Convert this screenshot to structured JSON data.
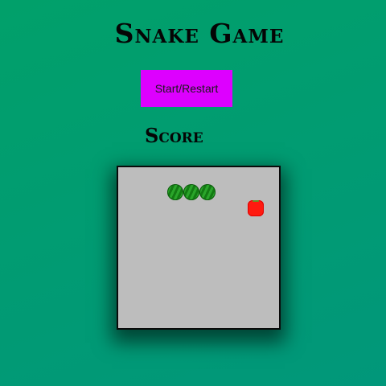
{
  "title": "Snake Game",
  "start_button": {
    "label": "Start/Restart"
  },
  "score": {
    "label": "Score"
  },
  "board": {
    "cells": [
      10,
      10
    ],
    "snake": [
      [
        3,
        1
      ],
      [
        4,
        1
      ],
      [
        5,
        1
      ]
    ],
    "food": [
      8,
      2
    ],
    "colors": {
      "background": "#bdbdbd",
      "snake": "#1f8f1f",
      "food": "#ff1a10"
    }
  }
}
